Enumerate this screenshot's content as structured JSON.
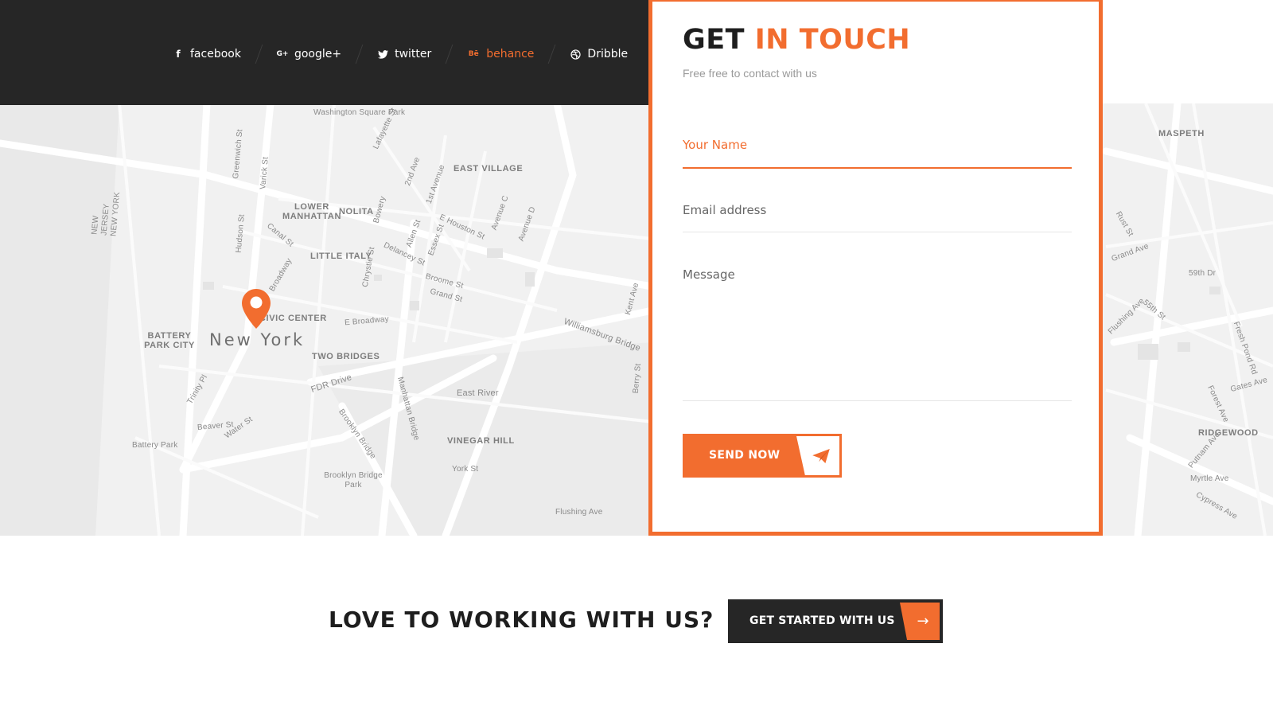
{
  "social": {
    "items": [
      {
        "label": "facebook",
        "icon": "facebook-icon",
        "glyph": "f",
        "active": false
      },
      {
        "label": "google+",
        "icon": "google-plus-icon",
        "glyph": "G+",
        "active": false
      },
      {
        "label": "twitter",
        "icon": "twitter-icon",
        "glyph": "🐦",
        "active": false
      },
      {
        "label": "behance",
        "icon": "behance-icon",
        "glyph": "Bē",
        "active": true
      },
      {
        "label": "Dribble",
        "icon": "dribbble-icon",
        "glyph": "◍",
        "active": false
      }
    ]
  },
  "map": {
    "city": "New York",
    "labels": [
      "Washington Square Park",
      "EAST VILLAGE",
      "LOWER MANHATTAN",
      "NOLITA",
      "LITTLE ITALY",
      "BATTERY PARK CITY",
      "CIVIC CENTER",
      "TWO BRIDGES",
      "VINEGAR HILL",
      "Brooklyn Bridge Park",
      "Battery Park",
      "East River",
      "FDR Drive",
      "Williamsburg Bridge",
      "E Broadway",
      "Flushing Ave",
      "NEW JERSEY NEW YORK",
      "MASPETH",
      "RIDGEWOOD",
      "Grand Ave",
      "Myrtle Ave",
      "Cypress Ave",
      "Gates Ave",
      "Putnam Ave",
      "Fresh Pond Rd",
      "Forest Ave",
      "Flushing Ave",
      "59th Dr",
      "Hudson St",
      "Varick St",
      "Canal St",
      "Broadway",
      "Grand St",
      "Broome St",
      "Delancey St",
      "Allen St",
      "Essex St",
      "E Houston St",
      "Bowery",
      "Chrystie St",
      "Lafayette St",
      "2nd Ave",
      "1st Avenue",
      "Avenue C",
      "Avenue D",
      "Greenwich St",
      "Trinity Pl",
      "Water St",
      "Beaver St",
      "Manhattan Bridge",
      "Brooklyn Bridge",
      "York St",
      "Kent Ave",
      "Berry St",
      "Rust St",
      "55th St"
    ]
  },
  "contact": {
    "title_main": "GET",
    "title_accent": "IN TOUCH",
    "subtitle": "Free free to contact with us",
    "name_placeholder": "Your Name",
    "email_placeholder": "Email address",
    "message_placeholder": "Message",
    "send_label": "SEND NOW",
    "send_icon": "paper-plane-icon"
  },
  "cta": {
    "heading": "LOVE TO WORKING WITH US?",
    "button_label": "GET STARTED WITH US",
    "button_icon": "arrow-right-icon",
    "arrow_glyph": "→"
  },
  "colors": {
    "accent": "#f26d2f",
    "dark": "#262626",
    "map_bg": "#f2f2f2"
  }
}
